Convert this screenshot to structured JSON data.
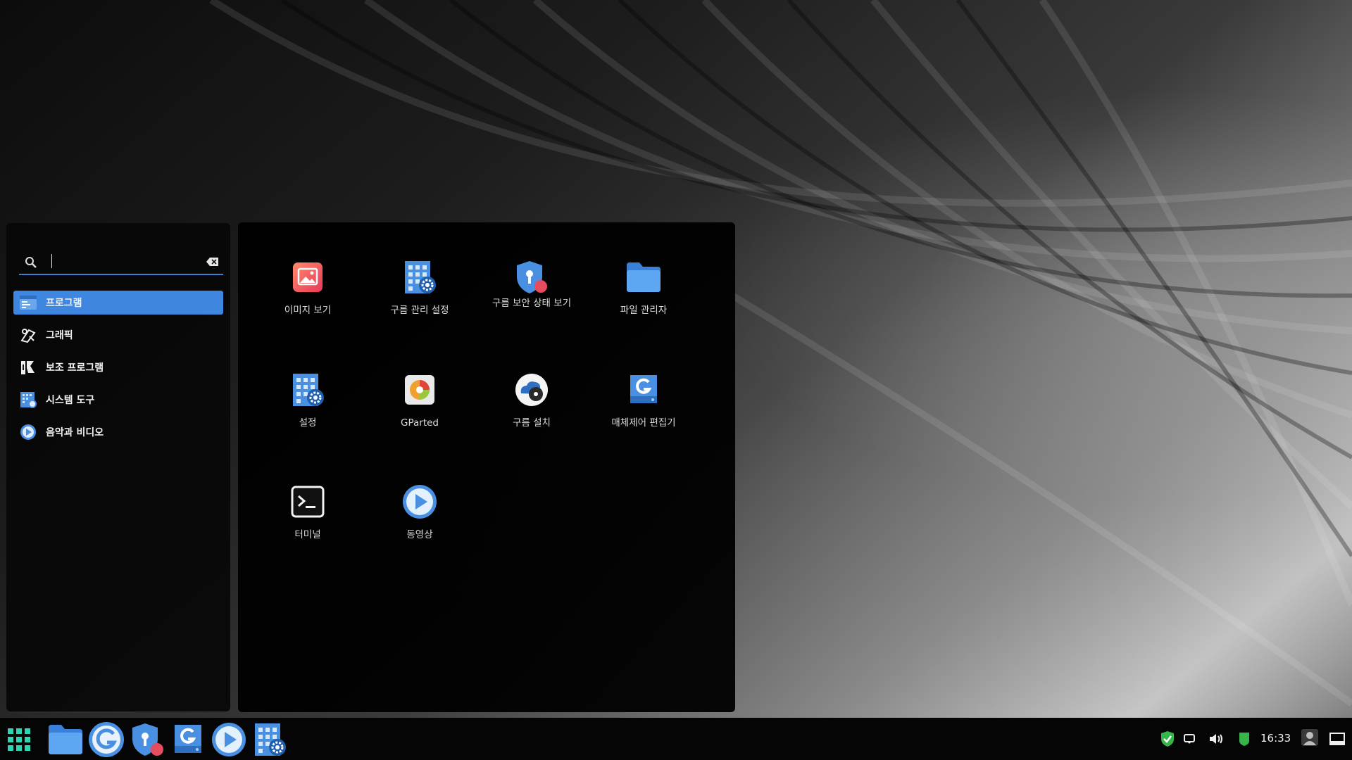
{
  "search": {
    "value": "",
    "placeholder": ""
  },
  "categories": [
    {
      "label": "프로그램",
      "icon": "programs-icon",
      "selected": true
    },
    {
      "label": "그래픽",
      "icon": "graphics-icon",
      "selected": false
    },
    {
      "label": "보조 프로그램",
      "icon": "accessories-icon",
      "selected": false
    },
    {
      "label": "시스템 도구",
      "icon": "system-tools-icon",
      "selected": false
    },
    {
      "label": "음악과 비디오",
      "icon": "music-video-icon",
      "selected": false
    }
  ],
  "apps": [
    {
      "label": "이미지 보기",
      "icon": "image-viewer-icon"
    },
    {
      "label": "구름 관리 설정",
      "icon": "gooroom-management-settings-icon"
    },
    {
      "label": "구름 보안 상태 보기",
      "icon": "gooroom-security-status-icon"
    },
    {
      "label": "파일 관리자",
      "icon": "file-manager-icon"
    },
    {
      "label": "설정",
      "icon": "settings-icon"
    },
    {
      "label": "GParted",
      "icon": "gparted-icon"
    },
    {
      "label": "구름 설치",
      "icon": "gooroom-install-icon"
    },
    {
      "label": "매체제어 편집기",
      "icon": "media-control-editor-icon"
    },
    {
      "label": "터미널",
      "icon": "terminal-icon"
    },
    {
      "label": "동영상",
      "icon": "video-player-icon"
    }
  ],
  "taskbar": {
    "launcher_icon": "app-grid-icon",
    "pinned": [
      "file-manager-icon",
      "gooroom-browser-icon",
      "gooroom-security-status-icon",
      "media-control-editor-icon",
      "video-player-icon",
      "gooroom-management-settings-icon"
    ],
    "tray": [
      "security-shield-icon",
      "notification-icon",
      "volume-icon",
      "battery-icon"
    ],
    "clock": "16:33",
    "user_icon": "user-icon",
    "show_desktop_icon": "show-desktop-icon"
  },
  "colors": {
    "accent": "#3f86e0",
    "icon_blue": "#4a90e2",
    "alert_red": "#e74c5e",
    "tray_green": "#35b54a"
  }
}
